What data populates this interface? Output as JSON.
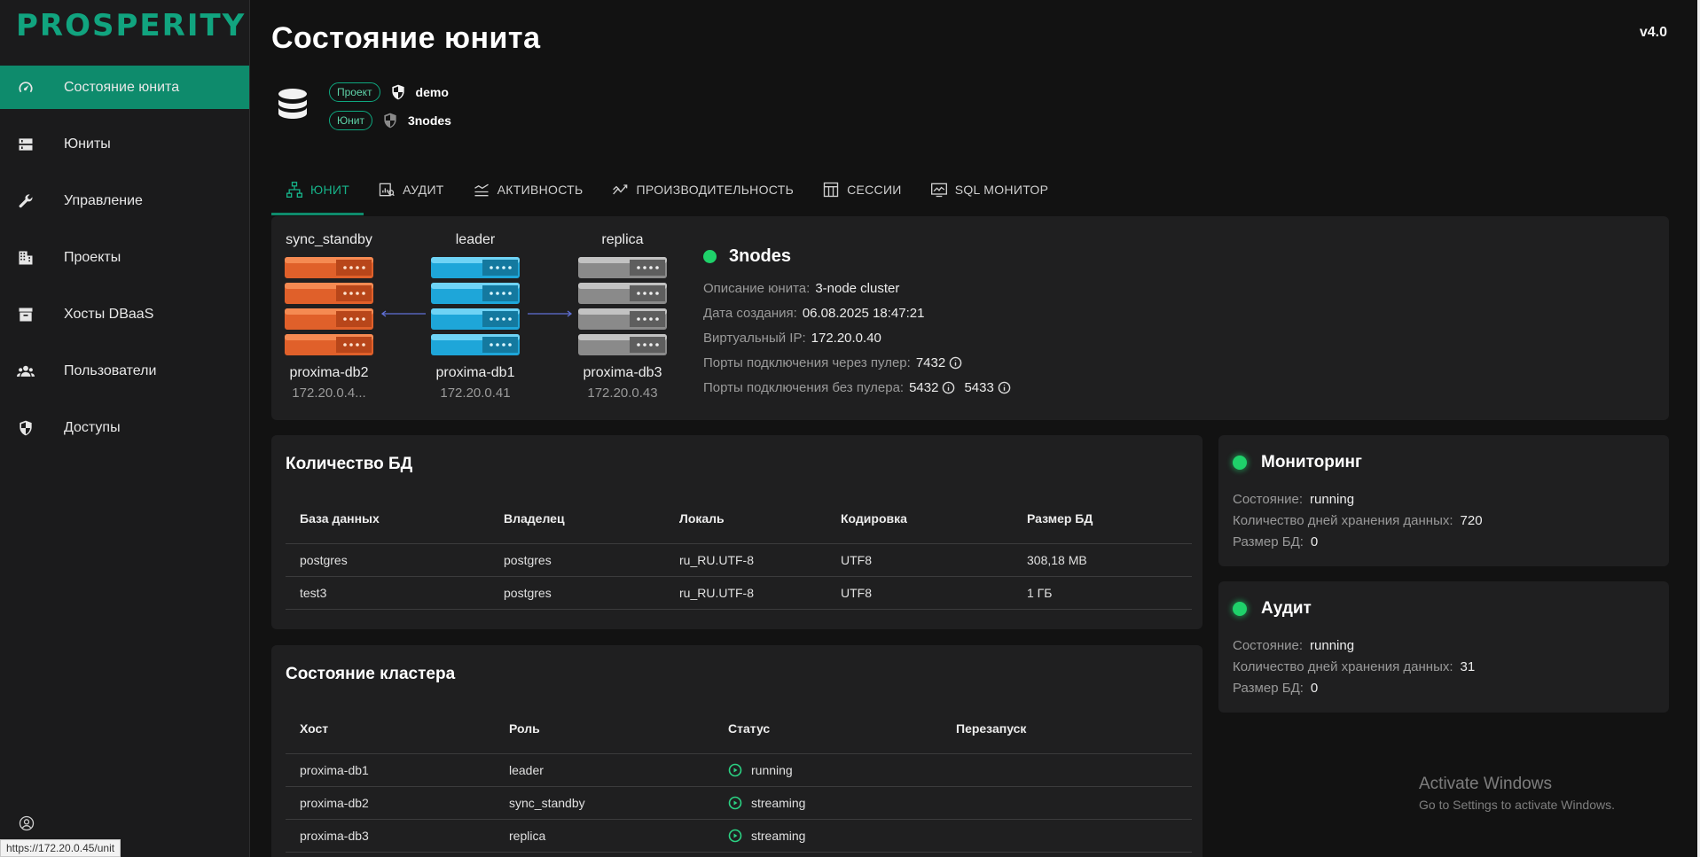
{
  "brand": {
    "name": "PROSPERITY",
    "color": "#11a47f"
  },
  "version": "v4.0",
  "page_title": "Состояние юнита",
  "sidebar": {
    "items": [
      {
        "label": "Состояние юнита",
        "icon": "speedometer-icon",
        "active": true
      },
      {
        "label": "Юниты",
        "icon": "server-icon",
        "active": false
      },
      {
        "label": "Управление",
        "icon": "wrench-icon",
        "active": false
      },
      {
        "label": "Проекты",
        "icon": "building-icon",
        "active": false
      },
      {
        "label": "Хосты DBaaS",
        "icon": "archive-icon",
        "active": false
      },
      {
        "label": "Пользователи",
        "icon": "users-icon",
        "active": false
      },
      {
        "label": "Доступы",
        "icon": "shield-icon",
        "active": false
      }
    ],
    "bottom_icon": "user-circle-icon"
  },
  "status_url": "https://172.20.0.45/unit",
  "unit_header": {
    "project_badge": "Проект",
    "project_name": "demo",
    "unit_badge": "Юнит",
    "unit_name": "3nodes"
  },
  "tabs": [
    {
      "label": "ЮНИТ",
      "icon": "sitemap-icon",
      "active": true
    },
    {
      "label": "АУДИТ",
      "icon": "report-icon",
      "active": false
    },
    {
      "label": "АКТИВНОСТЬ",
      "icon": "activity-icon",
      "active": false
    },
    {
      "label": "ПРОИЗВОДИТЕЛЬНОСТЬ",
      "icon": "trend-icon",
      "active": false
    },
    {
      "label": "СЕССИИ",
      "icon": "table-icon",
      "active": false
    },
    {
      "label": "SQL МОНИТОР",
      "icon": "monitor-chart-icon",
      "active": false
    }
  ],
  "topology": {
    "nodes": [
      {
        "role": "sync_standby",
        "name": "proxima-db2",
        "ip": "172.20.0.4...",
        "color": "#e0602a"
      },
      {
        "role": "leader",
        "name": "proxima-db1",
        "ip": "172.20.0.41",
        "color": "#1ea6d9"
      },
      {
        "role": "replica",
        "name": "proxima-db3",
        "ip": "172.20.0.43",
        "color": "#8a8a8a"
      }
    ],
    "arrow_color": "#5f6fd6"
  },
  "unit_info": {
    "name": "3nodes",
    "status_color": "#1fd16a",
    "description_label": "Описание юнита:",
    "description": "3-node cluster",
    "created_label": "Дата создания:",
    "created": "06.08.2025 18:47:21",
    "vip_label": "Виртуальный IP:",
    "vip": "172.20.0.40",
    "pooler_ports_label": "Порты подключения через пулер:",
    "pooler_ports": [
      "7432"
    ],
    "direct_ports_label": "Порты подключения без пулера:",
    "direct_ports": [
      "5432",
      "5433"
    ]
  },
  "db_count": {
    "title": "Количество БД",
    "columns": [
      "База данных",
      "Владелец",
      "Локаль",
      "Кодировка",
      "Размер БД"
    ],
    "rows": [
      [
        "postgres",
        "postgres",
        "ru_RU.UTF-8",
        "UTF8",
        "308,18 МВ"
      ],
      [
        "test3",
        "postgres",
        "ru_RU.UTF-8",
        "UTF8",
        "1 ГБ"
      ]
    ]
  },
  "cluster": {
    "title": "Состояние кластера",
    "columns": [
      "Хост",
      "Роль",
      "Статус",
      "Перезапуск"
    ],
    "rows": [
      {
        "host": "proxima-db1",
        "role": "leader",
        "status": "running",
        "restart": ""
      },
      {
        "host": "proxima-db2",
        "role": "sync_standby",
        "status": "streaming",
        "restart": ""
      },
      {
        "host": "proxima-db3",
        "role": "replica",
        "status": "streaming",
        "restart": ""
      }
    ]
  },
  "monitoring": {
    "title": "Мониторинг",
    "state_label": "Состояние:",
    "state": "running",
    "retention_label": "Количество дней хранения данных:",
    "retention": "720",
    "size_label": "Размер БД:",
    "size": "0"
  },
  "audit": {
    "title": "Аудит",
    "state_label": "Состояние:",
    "state": "running",
    "retention_label": "Количество дней хранения данных:",
    "retention": "31",
    "size_label": "Размер БД:",
    "size": "0"
  },
  "watermark": {
    "line1": "Activate Windows",
    "line2": "Go to Settings to activate Windows."
  }
}
